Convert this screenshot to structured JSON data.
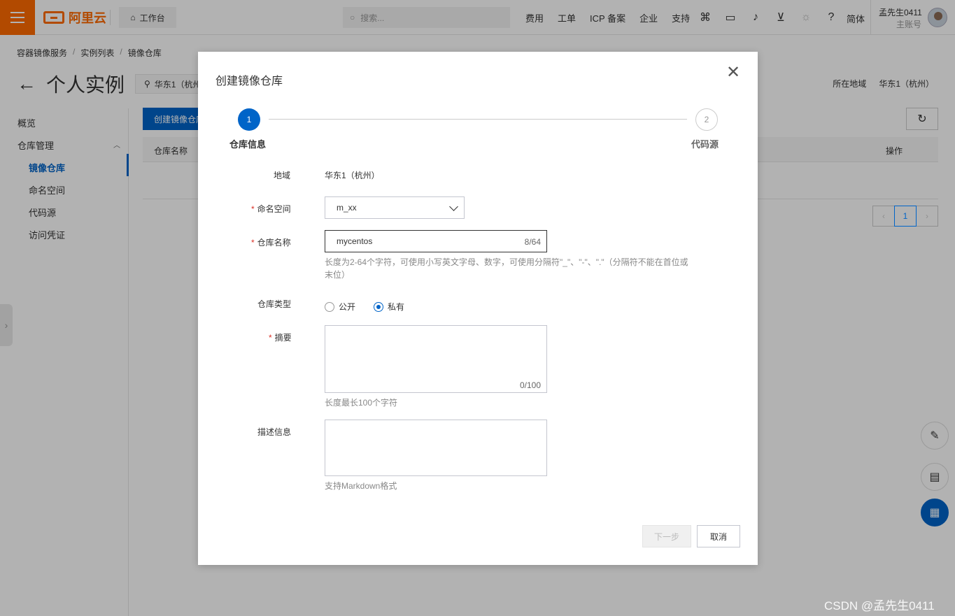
{
  "topbar": {
    "logo_text": "阿里云",
    "workbench": "工作台",
    "search_placeholder": "搜索...",
    "links": [
      "费用",
      "工单",
      "ICP 备案",
      "企业",
      "支持"
    ],
    "lang": "简体",
    "user_name": "孟先生0411",
    "user_role": "主账号",
    "icons": [
      "code-icon",
      "terminal-icon",
      "bell-icon",
      "cart-icon",
      "lightbulb-icon",
      "help-icon"
    ]
  },
  "breadcrumb": [
    "容器镜像服务",
    "实例列表",
    "镜像仓库"
  ],
  "header": {
    "title": "个人实例",
    "region_tag": "华东1（杭州）",
    "region_label": "所在地域",
    "region_value": "华东1（杭州）"
  },
  "sidebar": {
    "items": [
      {
        "label": "概览"
      },
      {
        "label": "仓库管理"
      },
      {
        "label": "镜像仓库"
      },
      {
        "label": "命名空间"
      },
      {
        "label": "代码源"
      },
      {
        "label": "访问凭证"
      }
    ]
  },
  "main": {
    "create_button": "创建镜像仓库",
    "col_name": "仓库名称",
    "col_op": "操作",
    "pager_current": "1"
  },
  "dialog": {
    "title": "创建镜像仓库",
    "steps": [
      {
        "num": "1",
        "label": "仓库信息"
      },
      {
        "num": "2",
        "label": "代码源"
      }
    ],
    "region_label": "地域",
    "region_value": "华东1（杭州）",
    "namespace_label": "命名空间",
    "namespace_value": "m_xx",
    "repo_name_label": "仓库名称",
    "repo_name_value": "mycentos",
    "repo_name_count": "8/64",
    "repo_name_hint": "长度为2-64个字符，可使用小写英文字母、数字，可使用分隔符\"_\"、\"-\"、\".\"（分隔符不能在首位或末位）",
    "repo_type_label": "仓库类型",
    "repo_type_options": [
      "公开",
      "私有"
    ],
    "repo_type_selected": "私有",
    "summary_label": "摘要",
    "summary_count": "0/100",
    "summary_hint": "长度最长100个字符",
    "desc_label": "描述信息",
    "desc_hint": "支持Markdown格式",
    "next_button": "下一步",
    "cancel_button": "取消"
  },
  "watermark": "CSDN @孟先生0411",
  "colors": {
    "accent": "#0064c8",
    "brand": "#ff6a00",
    "required": "#d93026"
  }
}
